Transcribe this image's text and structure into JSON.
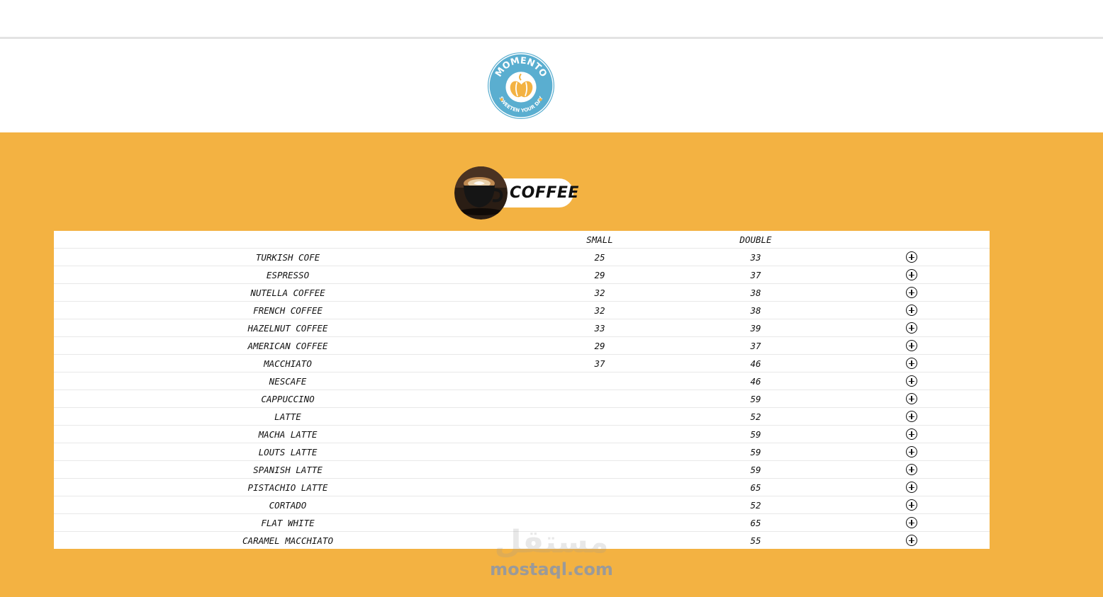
{
  "brand": {
    "name": "MOMENTO",
    "tagline": "SWEETEN YOUR DAY",
    "colors": {
      "ring": "#5aaed0",
      "accent": "#f3b242"
    }
  },
  "category": {
    "title": "COFFEE",
    "icon": "coffee-cup-image"
  },
  "table": {
    "headers": {
      "name": "",
      "small": "SMALL",
      "double": "DOUBLE",
      "action": ""
    },
    "add_icon": "plus-circle-icon",
    "rows": [
      {
        "name": "TURKISH COFE",
        "small": "25",
        "double": "33"
      },
      {
        "name": "ESPRESSO",
        "small": "29",
        "double": "37"
      },
      {
        "name": "NUTELLA COFFEE",
        "small": "32",
        "double": "38"
      },
      {
        "name": "FRENCH COFFEE",
        "small": "32",
        "double": "38"
      },
      {
        "name": "HAZELNUT COFFEE",
        "small": "33",
        "double": "39"
      },
      {
        "name": "AMERICAN COFFEE",
        "small": "29",
        "double": "37"
      },
      {
        "name": "MACCHIATO",
        "small": "37",
        "double": "46"
      },
      {
        "name": "NESCAFE",
        "small": "",
        "double": "46"
      },
      {
        "name": "CAPPUCCINO",
        "small": "",
        "double": "59"
      },
      {
        "name": "LATTE",
        "small": "",
        "double": "52"
      },
      {
        "name": "MACHA LATTE",
        "small": "",
        "double": "59"
      },
      {
        "name": "LOUTS LATTE",
        "small": "",
        "double": "59"
      },
      {
        "name": "SPANISH LATTE",
        "small": "",
        "double": "59"
      },
      {
        "name": "PISTACHIO LATTE",
        "small": "",
        "double": "65"
      },
      {
        "name": "CORTADO",
        "small": "",
        "double": "52"
      },
      {
        "name": "FLAT WHITE",
        "small": "",
        "double": "65"
      },
      {
        "name": "CARAMEL MACCHIATO",
        "small": "",
        "double": "55"
      }
    ]
  },
  "watermark": {
    "arabic": "مستقل",
    "latin": "mostaql.com"
  }
}
